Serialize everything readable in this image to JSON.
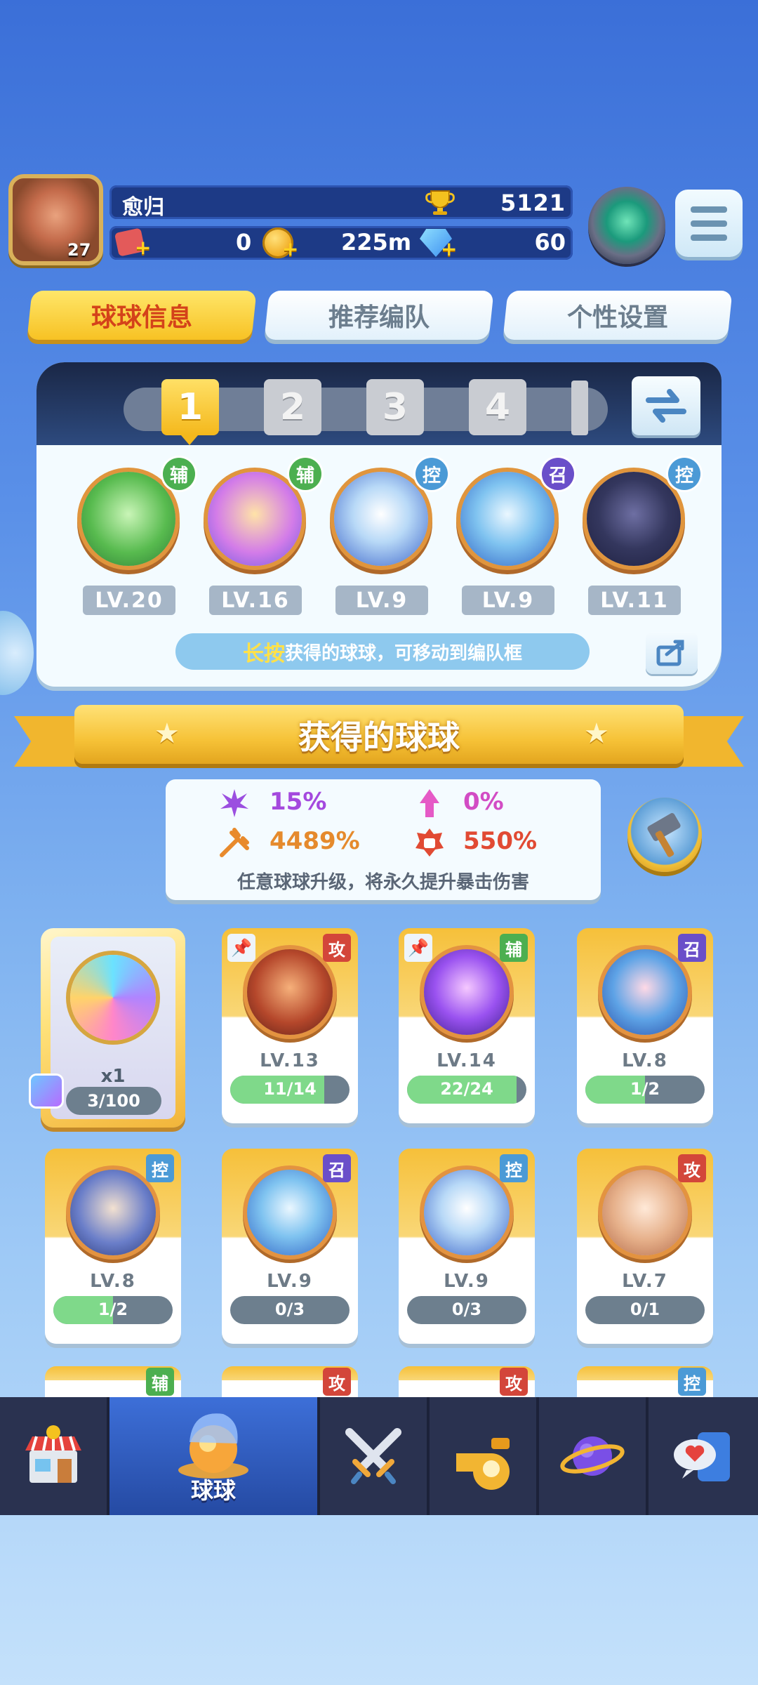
{
  "header": {
    "player_name": "愈归",
    "player_level": "27",
    "trophies": "5121",
    "tickets": "0",
    "coins": "225m",
    "gems": "60"
  },
  "tabs": [
    {
      "label": "球球信息",
      "active": true
    },
    {
      "label": "推荐编队",
      "active": false
    },
    {
      "label": "个性设置",
      "active": false
    }
  ],
  "team": {
    "slots": [
      "1",
      "2",
      "3",
      "4"
    ],
    "active_slot": "1",
    "members": [
      {
        "role": "辅",
        "level": "LV.20",
        "icon": "green-arrow-ball-icon"
      },
      {
        "role": "辅",
        "level": "LV.16",
        "icon": "rainbow-figures-ball-icon"
      },
      {
        "role": "控",
        "level": "LV.9",
        "icon": "white-hat-ball-icon"
      },
      {
        "role": "召",
        "level": "LV.9",
        "icon": "ice-shell-ball-icon"
      },
      {
        "role": "控",
        "level": "LV.11",
        "icon": "dark-knight-ball-icon"
      }
    ],
    "hint_highlight": "长按",
    "hint_text": "获得的球球，可移动到编队框"
  },
  "banner_title": "获得的球球",
  "crit": {
    "stat1": "15%",
    "stat2": "0%",
    "stat3": "4489%",
    "stat4": "550%",
    "note": "任意球球升级，将永久提升暴击伤害"
  },
  "special_card": {
    "multiplier": "x1",
    "progress": "3/100",
    "icon": "rainbow-swirl-ball-icon"
  },
  "balls": [
    {
      "role": "攻",
      "level": "LV.13",
      "progress": "11/14",
      "fraction": 0.79,
      "pinned": true,
      "icon": "infinity-ball-icon"
    },
    {
      "role": "辅",
      "level": "LV.14",
      "progress": "22/24",
      "fraction": 0.92,
      "pinned": true,
      "icon": "lightning-ball-icon"
    },
    {
      "role": "召",
      "level": "LV.8",
      "progress": "1/2",
      "fraction": 0.5,
      "pinned": false,
      "icon": "fish-ball-icon"
    },
    {
      "role": "控",
      "level": "LV.8",
      "progress": "1/2",
      "fraction": 0.5,
      "pinned": false,
      "icon": "swordsman-ball-icon"
    },
    {
      "role": "召",
      "level": "LV.9",
      "progress": "0/3",
      "fraction": 0,
      "pinned": false,
      "icon": "ice-shell-ball-icon"
    },
    {
      "role": "控",
      "level": "LV.9",
      "progress": "0/3",
      "fraction": 0,
      "pinned": false,
      "icon": "white-hat-ball-icon"
    },
    {
      "role": "攻",
      "level": "LV.7",
      "progress": "0/1",
      "fraction": 0,
      "pinned": false,
      "icon": "old-man-ball-icon"
    }
  ],
  "partial_row_roles": [
    "辅",
    "攻",
    "攻",
    "控"
  ],
  "nav": [
    {
      "icon": "shop-icon",
      "label": ""
    },
    {
      "icon": "balls-icon",
      "label": "球球",
      "active": true
    },
    {
      "icon": "crossed-swords-icon",
      "label": ""
    },
    {
      "icon": "whistle-icon",
      "label": ""
    },
    {
      "icon": "planet-icon",
      "label": ""
    },
    {
      "icon": "chat-icon",
      "label": ""
    }
  ],
  "colors": {
    "role_辅": "#4caf50",
    "role_控": "#4b9ad6",
    "role_召": "#6a4fc9",
    "role_攻": "#d3463a",
    "accent_gold": "#f6c237"
  }
}
